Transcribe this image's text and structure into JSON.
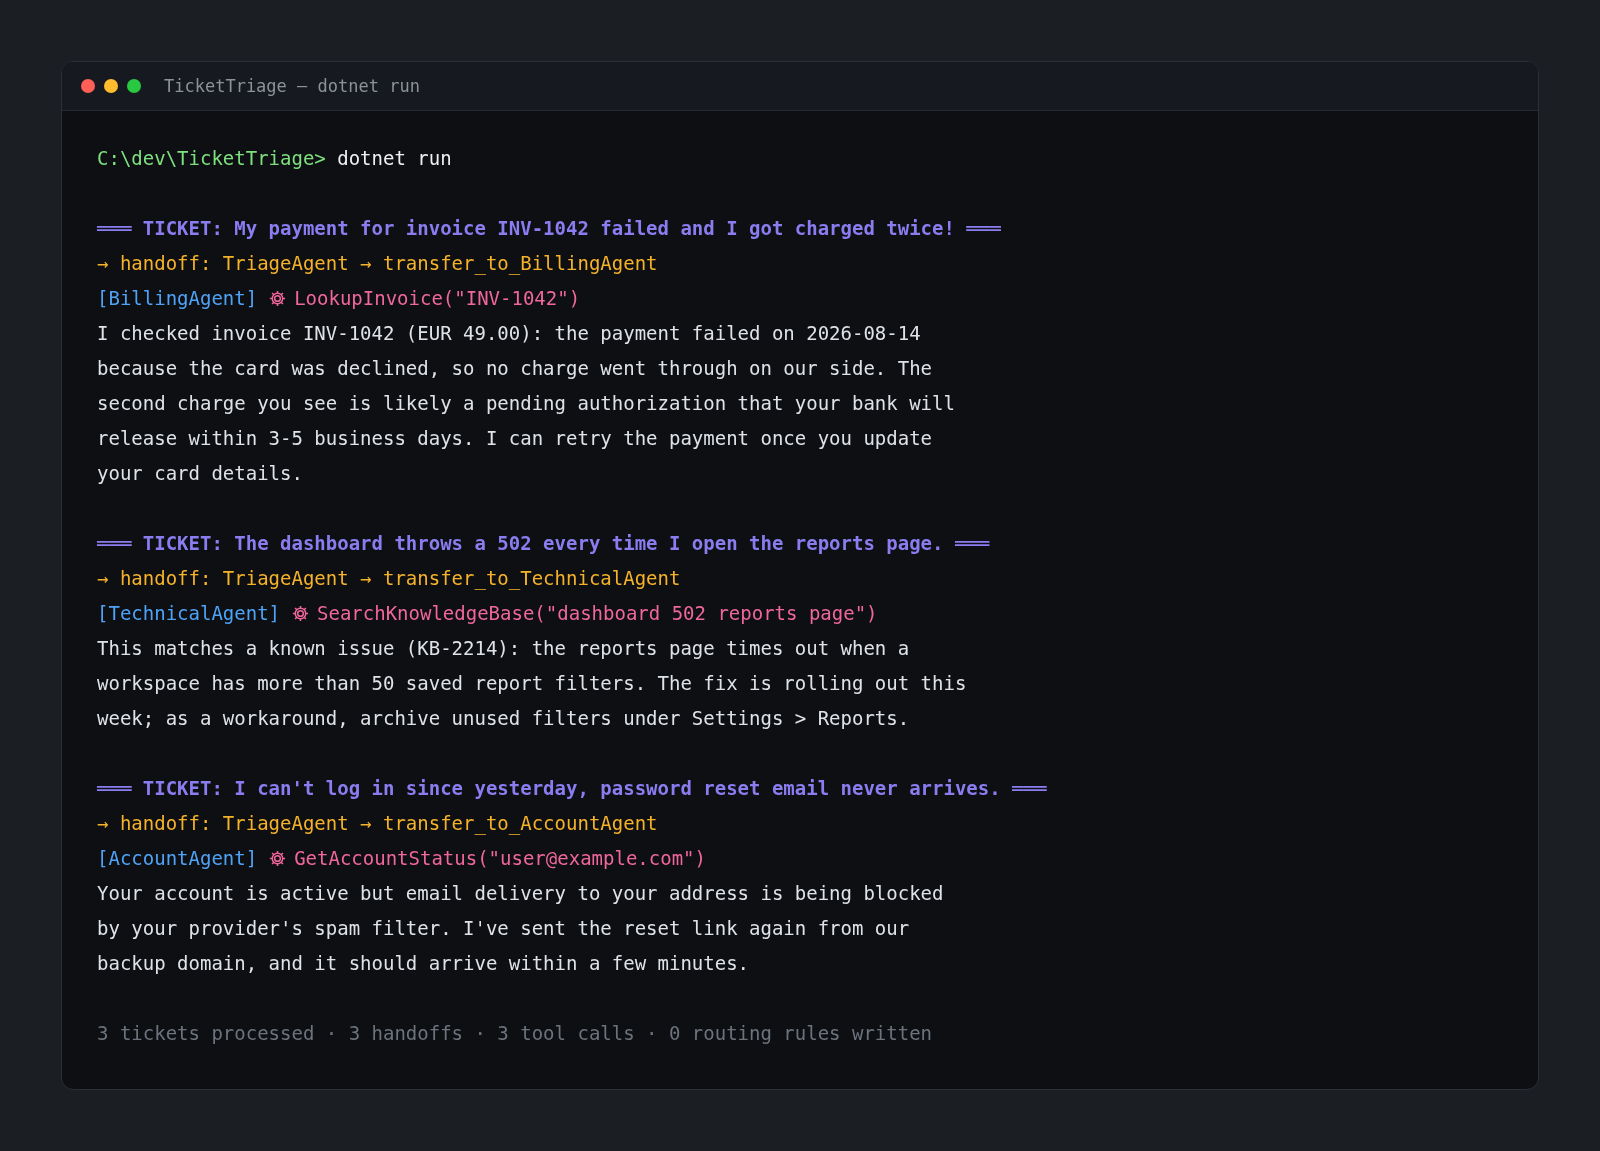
{
  "window": {
    "title": "TicketTriage — dotnet run"
  },
  "prompt": {
    "path": "C:\\dev\\TicketTriage>",
    "command": "dotnet run"
  },
  "tickets": [
    {
      "header": "═══ TICKET: My payment for invoice INV-1042 failed and I got charged twice! ═══",
      "handoff": "→ handoff: TriageAgent → transfer_to_BillingAgent",
      "agent": "[BillingAgent]",
      "tool_call": "LookupInvoice(\"INV-1042\")",
      "response": "I checked invoice INV-1042 (EUR 49.00): the payment failed on 2026-08-14 because the card was declined, so no charge went through on our side. The second charge you see is likely a pending authorization that your bank will release within 3-5 business days. I can retry the payment once you update your card details."
    },
    {
      "header": "═══ TICKET: The dashboard throws a 502 every time I open the reports page. ═══",
      "handoff": "→ handoff: TriageAgent → transfer_to_TechnicalAgent",
      "agent": "[TechnicalAgent]",
      "tool_call": "SearchKnowledgeBase(\"dashboard 502 reports page\")",
      "response": "This matches a known issue (KB-2214): the reports page times out when a workspace has more than 50 saved report filters. The fix is rolling out this week; as a workaround, archive unused filters under Settings > Reports."
    },
    {
      "header": "═══ TICKET: I can't log in since yesterday, password reset email never arrives. ═══",
      "handoff": "→ handoff: TriageAgent → transfer_to_AccountAgent",
      "agent": "[AccountAgent]",
      "tool_call": "GetAccountStatus(\"user@example.com\")",
      "response": "Your account is active but email delivery to your address is being blocked by your provider's spam filter. I've sent the reset link again from our backup domain, and it should arrive within a few minutes."
    }
  ],
  "summary": "3 tickets processed · 3 handoffs · 3 tool calls · 0 routing rules written"
}
